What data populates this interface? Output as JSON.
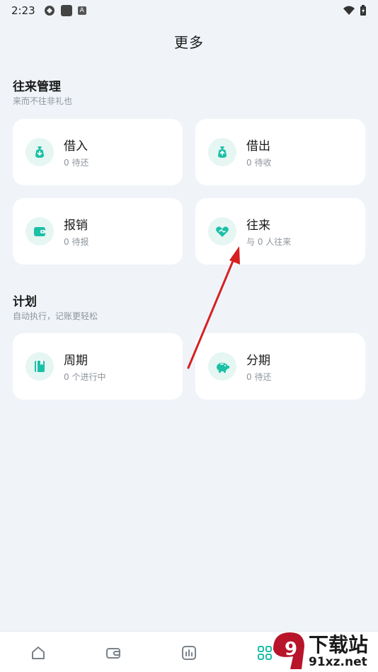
{
  "status_bar": {
    "time": "2:23",
    "a_badge": "A"
  },
  "page": {
    "title": "更多"
  },
  "sections": [
    {
      "title": "往来管理",
      "subtitle": "来而不往非礼也",
      "cards": [
        {
          "title": "借入",
          "subtitle": "0 待还",
          "icon": "money-bag-down-icon"
        },
        {
          "title": "借出",
          "subtitle": "0 待收",
          "icon": "money-bag-up-icon"
        },
        {
          "title": "报销",
          "subtitle": "0 待报",
          "icon": "wallet-icon"
        },
        {
          "title": "往来",
          "subtitle": "与 0 人往来",
          "icon": "handshake-heart-icon"
        }
      ]
    },
    {
      "title": "计划",
      "subtitle": "自动执行，记账更轻松",
      "cards": [
        {
          "title": "周期",
          "subtitle": "0 个进行中",
          "icon": "notebook-icon"
        },
        {
          "title": "分期",
          "subtitle": "0 待还",
          "icon": "piggy-bank-icon"
        }
      ]
    }
  ],
  "tabbar": {
    "items": [
      "home-icon",
      "wallet-icon",
      "chart-icon",
      "more-icon"
    ]
  },
  "watermark": {
    "main": "下载站",
    "site": "91xz.net",
    "logo": "9"
  },
  "colors": {
    "accent": "#1bc0a6",
    "accent_bg": "#e5f6f3",
    "background": "#f0f4f9",
    "annotation": "#d62020"
  }
}
